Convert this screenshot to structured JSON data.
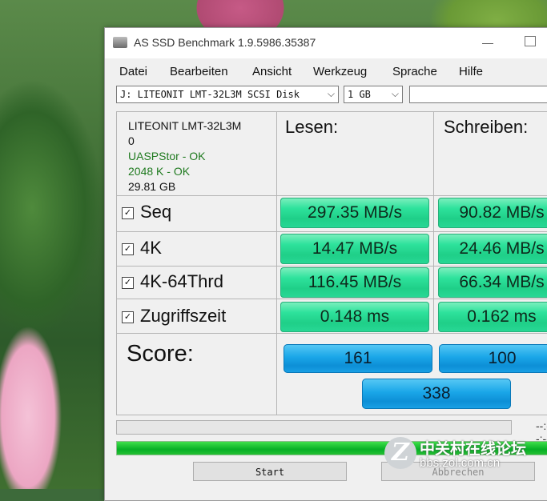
{
  "window": {
    "title": "AS SSD Benchmark 1.9.5986.35387",
    "minimize_glyph": "—"
  },
  "menu": [
    "Datei",
    "Bearbeiten",
    "Ansicht",
    "Werkzeug",
    "Sprache",
    "Hilfe"
  ],
  "toolbar": {
    "drive_select": "J: LITEONIT  LMT-32L3M SCSI Disk",
    "size_select": "1 GB",
    "extra_field": ""
  },
  "info": {
    "model": "LITEONIT  LMT-32L3M",
    "firmware": "0",
    "driver": "UASPStor - OK",
    "alignment": "2048 K - OK",
    "capacity": "29.81 GB"
  },
  "columns": {
    "read": "Lesen:",
    "write": "Schreiben:"
  },
  "rows": [
    {
      "label": "Seq",
      "read": "297.35 MB/s",
      "write": "90.82 MB/s"
    },
    {
      "label": "4K",
      "read": "14.47 MB/s",
      "write": "24.46 MB/s"
    },
    {
      "label": "4K-64Thrd",
      "read": "116.45 MB/s",
      "write": "66.34 MB/s"
    },
    {
      "label": "Zugriffszeit",
      "read": "0.148 ms",
      "write": "0.162 ms"
    }
  ],
  "checkbox_mark": "✓",
  "score": {
    "label": "Score:",
    "read": "161",
    "write": "100",
    "total": "338"
  },
  "progress": {
    "top_fraction": 0.0,
    "bottom_fraction": 1.0,
    "time_text": "--:--:--"
  },
  "buttons": {
    "start": "Start",
    "abort": "Abbrechen"
  },
  "watermark": {
    "logo": "Z",
    "name": "中关村在线论坛",
    "url": "bbs.zol.com.cn"
  },
  "colors": {
    "result_green": "#2ee29c",
    "score_blue": "#1aa6e8",
    "progress_green": "#06b025",
    "ok_green": "#1f7a1f"
  }
}
